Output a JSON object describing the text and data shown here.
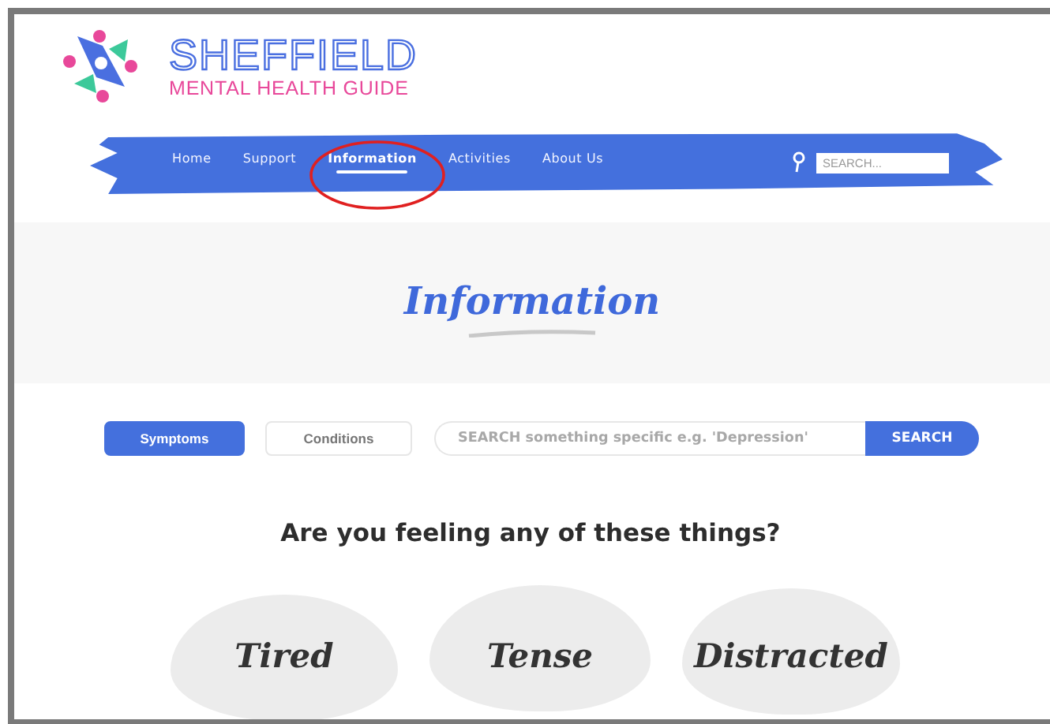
{
  "logo": {
    "title": "SHEFFIELD",
    "subtitle": "MENTAL HEALTH GUIDE"
  },
  "nav": {
    "items": [
      {
        "label": "Home",
        "selected": false
      },
      {
        "label": "Support",
        "selected": false
      },
      {
        "label": "Information",
        "selected": true
      },
      {
        "label": "Activities",
        "selected": false
      },
      {
        "label": "About Us",
        "selected": false
      }
    ],
    "search": {
      "placeholder": "SEARCH..."
    }
  },
  "banner": {
    "title": "Information"
  },
  "tabs": [
    {
      "label": "Symptoms",
      "selected": true
    },
    {
      "label": "Conditions",
      "selected": false
    }
  ],
  "search": {
    "placeholder": "SEARCH something specific e.g. 'Depression'",
    "button": "SEARCH"
  },
  "question": "Are you feeling any of these things?",
  "feelings": [
    "Tired",
    "Tense",
    "Distracted"
  ]
}
